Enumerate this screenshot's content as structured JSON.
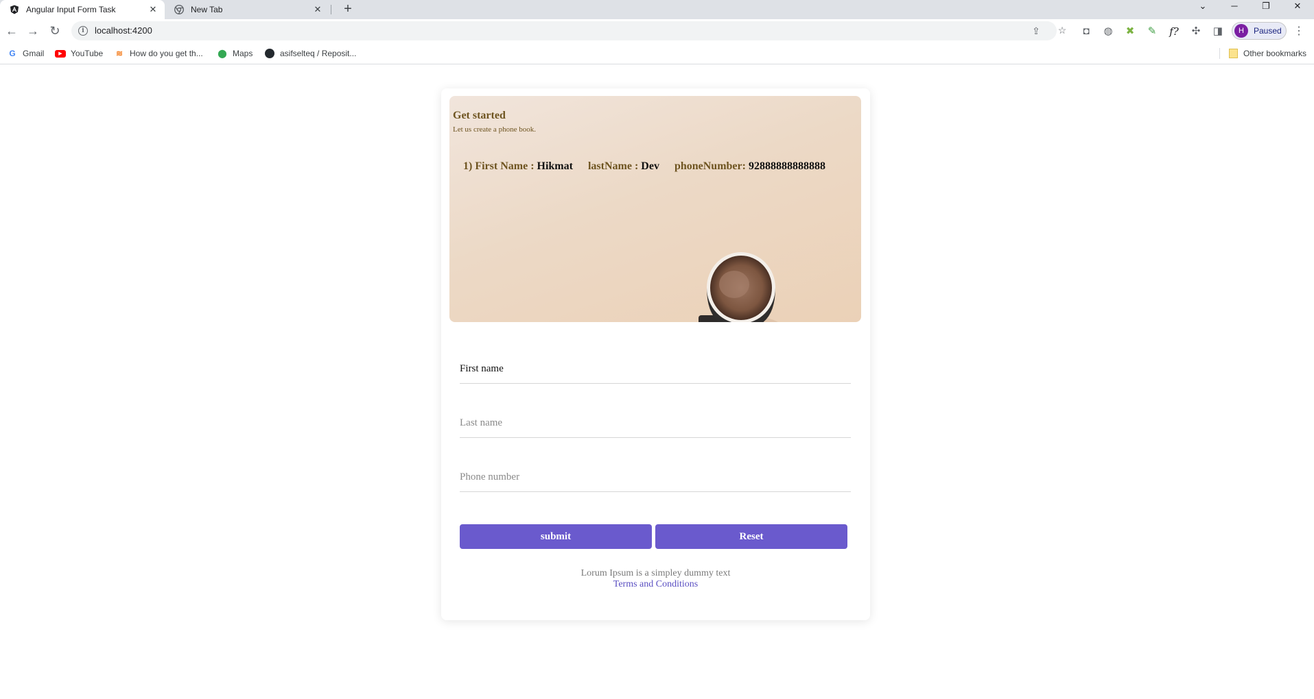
{
  "browser": {
    "tabs": [
      {
        "title": "Angular Input Form Task",
        "active": true
      },
      {
        "title": "New Tab",
        "active": false
      }
    ],
    "url": "localhost:4200",
    "profile_initial": "H",
    "profile_status": "Paused",
    "bookmarks": [
      {
        "label": "Gmail",
        "icon": "gmail-icon"
      },
      {
        "label": "YouTube",
        "icon": "youtube-icon"
      },
      {
        "label": "How do you get th...",
        "icon": "stackoverflow-icon"
      },
      {
        "label": "Maps",
        "icon": "maps-icon"
      },
      {
        "label": "asifselteq / Reposit...",
        "icon": "github-icon"
      }
    ],
    "other_bookmarks": "Other bookmarks"
  },
  "hero": {
    "title": "Get started",
    "subtitle": "Let us create a phone book.",
    "entries": [
      {
        "index_label": "1) First Name :",
        "first_name": "Hikmat",
        "last_name_label": "lastName :",
        "last_name": "Dev",
        "phone_label": "phoneNumber:",
        "phone": "92888888888888"
      }
    ]
  },
  "form": {
    "first_name_placeholder": "First name",
    "last_name_placeholder": "Last name",
    "phone_placeholder": "Phone number",
    "submit_label": "submit",
    "reset_label": "Reset"
  },
  "footer": {
    "text": "Lorum Ipsum is a simpley dummy text",
    "terms_link": "Terms and Conditions"
  },
  "colors": {
    "accent": "#6a5acd",
    "label_brown": "#6e5420",
    "link": "#5a4fc2"
  }
}
